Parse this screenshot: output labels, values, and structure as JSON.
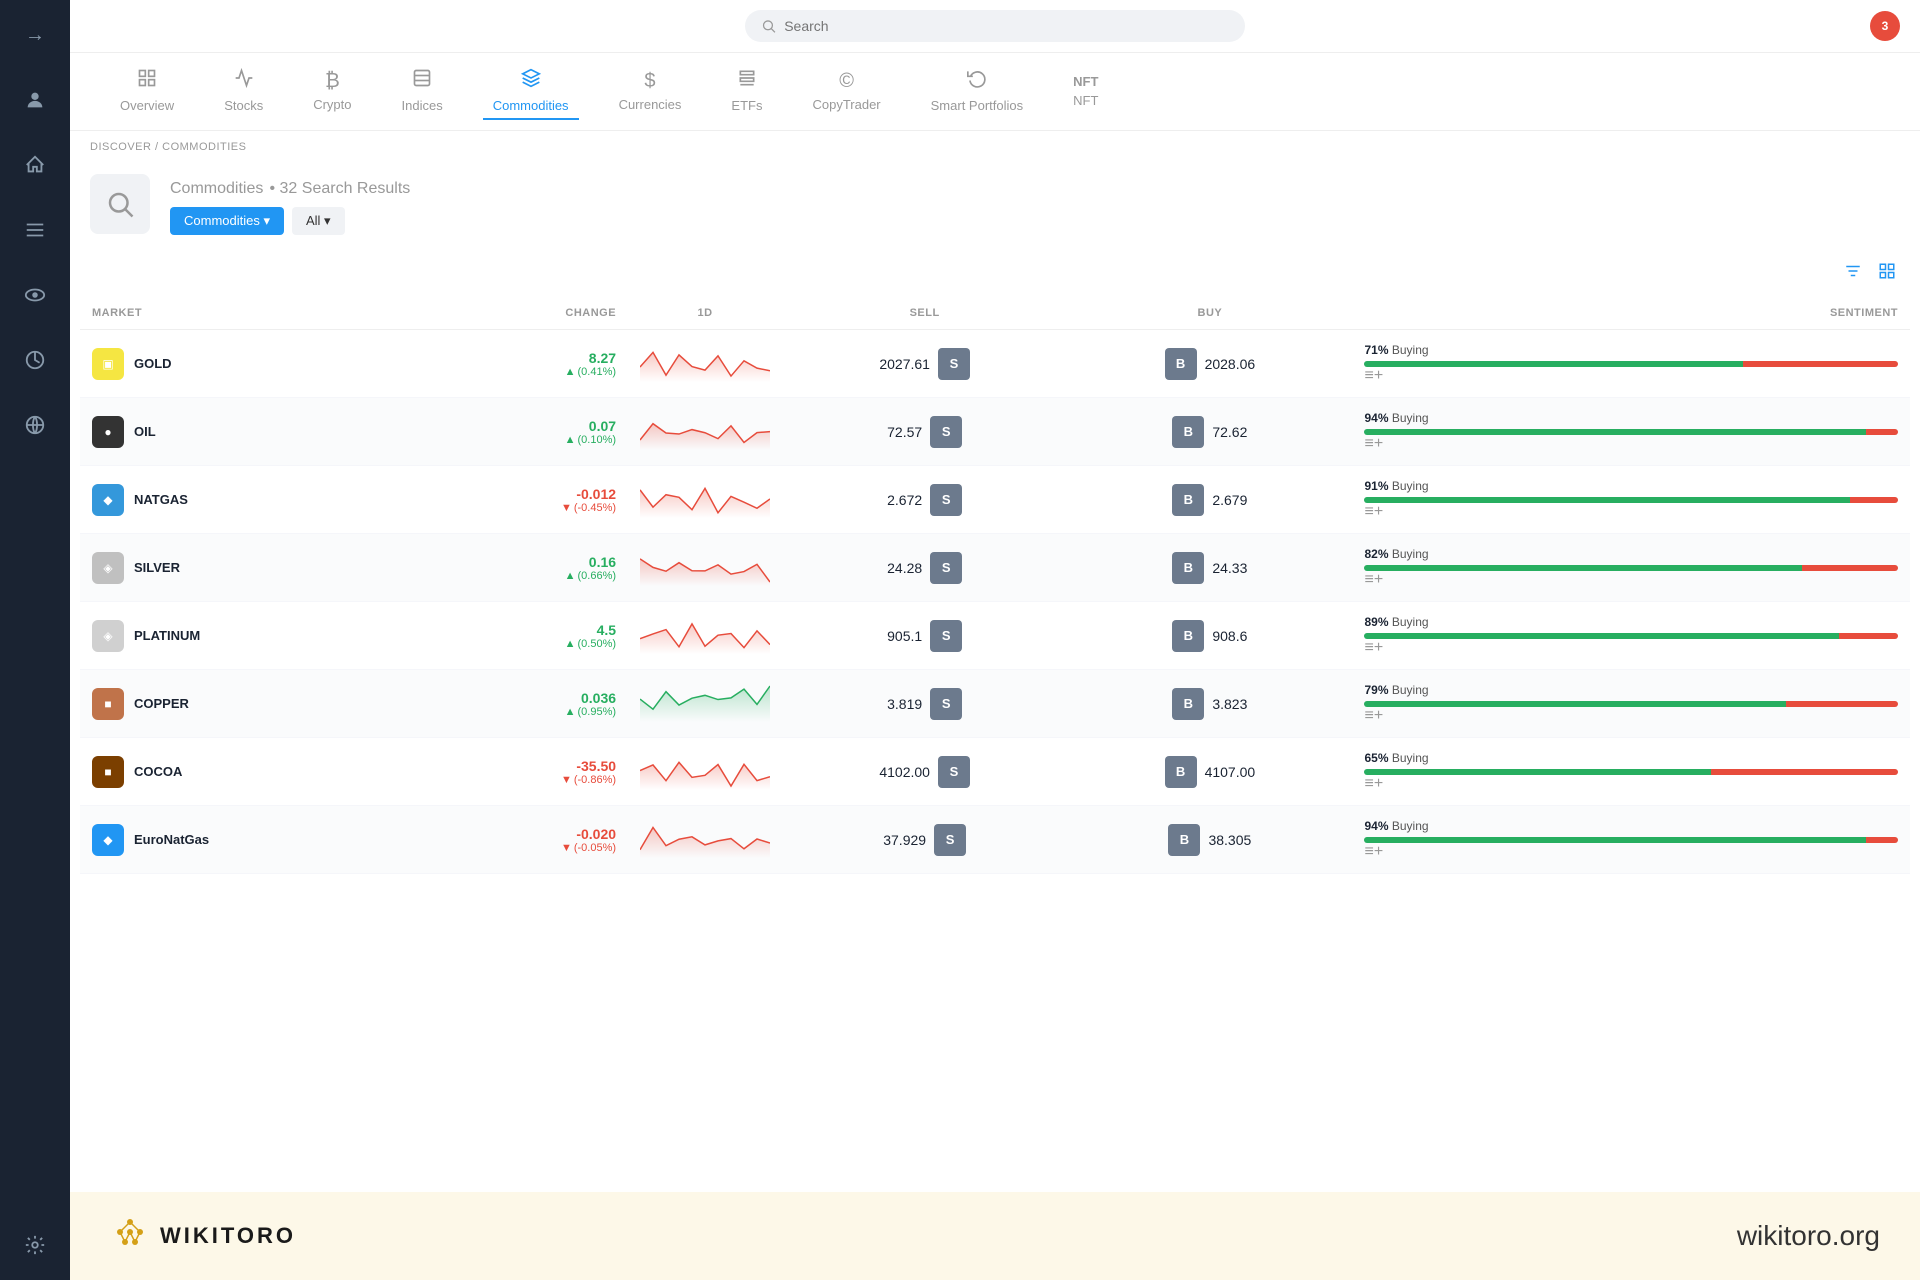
{
  "sidebar": {
    "icons": [
      {
        "name": "arrow-right-icon",
        "symbol": "→",
        "active": false
      },
      {
        "name": "avatar-icon",
        "symbol": "👤",
        "active": false
      },
      {
        "name": "home-icon",
        "symbol": "⌂",
        "active": false
      },
      {
        "name": "feed-icon",
        "symbol": "≡",
        "active": false
      },
      {
        "name": "watchlist-icon",
        "symbol": "👁",
        "active": false
      },
      {
        "name": "portfolio-icon",
        "symbol": "◕",
        "active": false
      },
      {
        "name": "globe-icon",
        "symbol": "🌐",
        "active": false
      }
    ],
    "bottom_icons": [
      {
        "name": "settings-icon",
        "symbol": "⚙",
        "active": false
      }
    ]
  },
  "topbar": {
    "search_placeholder": "Search",
    "notification_count": "3"
  },
  "nav_tabs": [
    {
      "id": "overview",
      "label": "Overview",
      "icon": "⊞",
      "active": false
    },
    {
      "id": "stocks",
      "label": "Stocks",
      "icon": "📊",
      "active": false
    },
    {
      "id": "crypto",
      "label": "Crypto",
      "icon": "₿",
      "active": false
    },
    {
      "id": "indices",
      "label": "Indices",
      "icon": "📋",
      "active": false
    },
    {
      "id": "commodities",
      "label": "Commodities",
      "icon": "⚖",
      "active": true
    },
    {
      "id": "currencies",
      "label": "Currencies",
      "icon": "$",
      "active": false
    },
    {
      "id": "etfs",
      "label": "ETFs",
      "icon": "📰",
      "active": false
    },
    {
      "id": "copytrader",
      "label": "CopyTrader",
      "icon": "©",
      "active": false
    },
    {
      "id": "smart-portfolios",
      "label": "Smart Portfolios",
      "icon": "🔄",
      "active": false
    },
    {
      "id": "nft",
      "label": "NFT",
      "icon": "NFT",
      "active": false
    }
  ],
  "breadcrumb": "DISCOVER / COMMODITIES",
  "page_header": {
    "title": "Commodities",
    "results": "• 32 Search Results",
    "filter1_label": "Commodities ▾",
    "filter2_label": "All ▾"
  },
  "table": {
    "columns": [
      "MARKET",
      "CHANGE",
      "1D",
      "SELL",
      "BUY",
      "SENTIMENT"
    ],
    "rows": [
      {
        "market": "GOLD",
        "icon": "🟡",
        "icon_bg": "#f5e642",
        "change_val": "8.27",
        "change_pct": "(0.41%)",
        "change_positive": true,
        "sell": "2027.61",
        "buy": "2028.06",
        "sentiment_pct": 71,
        "sentiment_label": "Buying",
        "chart_color": "#e74c3c",
        "chart_positive": false
      },
      {
        "market": "OIL",
        "icon": "⚫",
        "icon_bg": "#333",
        "change_val": "0.07",
        "change_pct": "(0.10%)",
        "change_positive": true,
        "sell": "72.57",
        "buy": "72.62",
        "sentiment_pct": 94,
        "sentiment_label": "Buying",
        "chart_color": "#e74c3c",
        "chart_positive": false
      },
      {
        "market": "NATGAS",
        "icon": "🔵",
        "icon_bg": "#3498db",
        "change_val": "-0.012",
        "change_pct": "(-0.45%)",
        "change_positive": false,
        "sell": "2.672",
        "buy": "2.679",
        "sentiment_pct": 91,
        "sentiment_label": "Buying",
        "chart_color": "#e74c3c",
        "chart_positive": false
      },
      {
        "market": "SILVER",
        "icon": "⬜",
        "icon_bg": "#aaa",
        "change_val": "0.16",
        "change_pct": "(0.66%)",
        "change_positive": true,
        "sell": "24.28",
        "buy": "24.33",
        "sentiment_pct": 82,
        "sentiment_label": "Buying",
        "chart_color": "#e74c3c",
        "chart_positive": false
      },
      {
        "market": "PLATINUM",
        "icon": "⬜",
        "icon_bg": "#bbb",
        "change_val": "4.5",
        "change_pct": "(0.50%)",
        "change_positive": true,
        "sell": "905.1",
        "buy": "908.6",
        "sentiment_pct": 89,
        "sentiment_label": "Buying",
        "chart_color": "#e74c3c",
        "chart_positive": false
      },
      {
        "market": "COPPER",
        "icon": "🟤",
        "icon_bg": "#c0734a",
        "change_val": "0.036",
        "change_pct": "(0.95%)",
        "change_positive": true,
        "sell": "3.819",
        "buy": "3.823",
        "sentiment_pct": 79,
        "sentiment_label": "Buying",
        "chart_color": "#27ae60",
        "chart_positive": true
      },
      {
        "market": "COCOA",
        "icon": "🟫",
        "icon_bg": "#7B3F00",
        "change_val": "-35.50",
        "change_pct": "(-0.86%)",
        "change_positive": false,
        "sell": "4102.00",
        "buy": "4107.00",
        "sentiment_pct": 65,
        "sentiment_label": "Buying",
        "chart_color": "#e74c3c",
        "chart_positive": false
      },
      {
        "market": "EuroNatGas",
        "icon": "🔵",
        "icon_bg": "#2196F3",
        "change_val": "-0.020",
        "change_pct": "(-0.05%)",
        "change_positive": false,
        "sell": "37.929",
        "buy": "38.305",
        "sentiment_pct": 94,
        "sentiment_label": "Buying",
        "chart_color": "#e74c3c",
        "chart_positive": false
      }
    ]
  },
  "footer": {
    "logo_icon": "✦",
    "logo_text": "WIKITORO",
    "url": "wikitoro.org"
  }
}
